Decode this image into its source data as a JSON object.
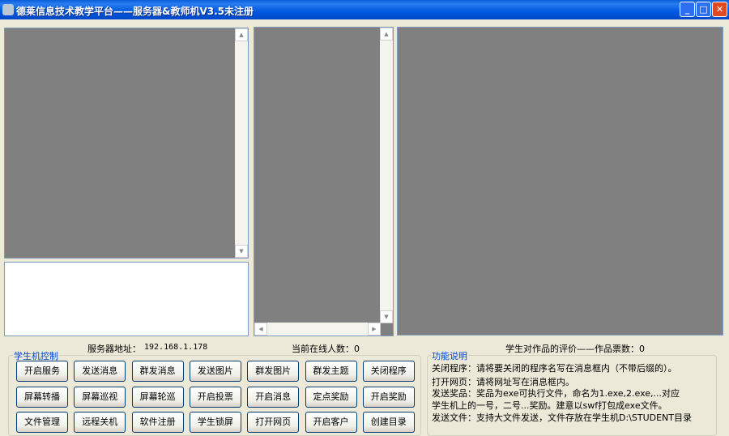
{
  "window": {
    "title": "德莱信息技术教学平台——服务器&教师机V3.5未注册",
    "minimize": "_",
    "maximize": "□",
    "close": "✕"
  },
  "status": {
    "server_address_label": "服务器地址：",
    "server_address": "192.168.1.178",
    "online_count": "当前在线人数：0",
    "rating": "学生对作品的评价——作品票数：0"
  },
  "control_group": {
    "title": "学生机控制",
    "buttons": [
      [
        "开启服务",
        "发送消息",
        "群发消息",
        "发送图片",
        "群发图片",
        "群发主题",
        "关闭程序"
      ],
      [
        "屏幕转播",
        "屏幕巡视",
        "屏幕轮巡",
        "开启投票",
        "开启消息",
        "定点奖励",
        "开启奖励"
      ],
      [
        "文件管理",
        "远程关机",
        "软件注册",
        "学生锁屏",
        "打开网页",
        "开启客户",
        "创建目录"
      ]
    ]
  },
  "help_group": {
    "title": "功能说明",
    "lines": [
      "关闭程序：请将要关闭的程序名写在消息框内（不带后缀的）。",
      "打开网页：请将网址写在消息框内。",
      "发送奖品：奖品为exe可执行文件，命名为1.exe,2.exe,...对应",
      "学生机上的一号，二号...奖励。建意以swf打包成exe文件。",
      "发送文件：支持大文件发送，文件存放在学生机D:\\STUDENT目录"
    ]
  }
}
